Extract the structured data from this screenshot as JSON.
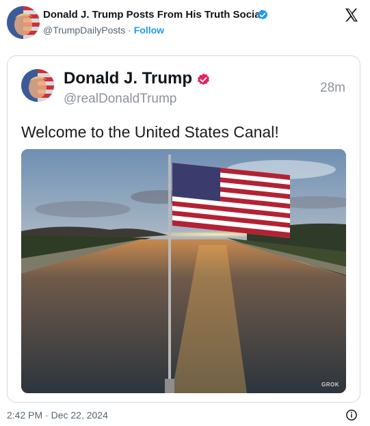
{
  "header": {
    "author_name": "Donald J. Trump Posts From His Truth Social",
    "handle": "@TrumpDailyPosts",
    "separator": "·",
    "follow_label": "Follow",
    "verified_icon": "verified-badge-icon",
    "platform_icon": "x-logo-icon"
  },
  "embedded_post": {
    "name": "Donald J. Trump",
    "handle": "@realDonaldTrump",
    "time_ago": "28m",
    "verified_icon": "verified-badge-icon",
    "text": "Welcome to the United States Canal!",
    "image_watermark": "GROK"
  },
  "footer": {
    "timestamp": "2:42 PM · Dec 22, 2024",
    "info_icon": "info-icon"
  },
  "colors": {
    "accent_blue": "#1d9bf0",
    "verified_pink": "#e0245e",
    "text_secondary": "#536471",
    "card_border": "#cfd9de"
  }
}
